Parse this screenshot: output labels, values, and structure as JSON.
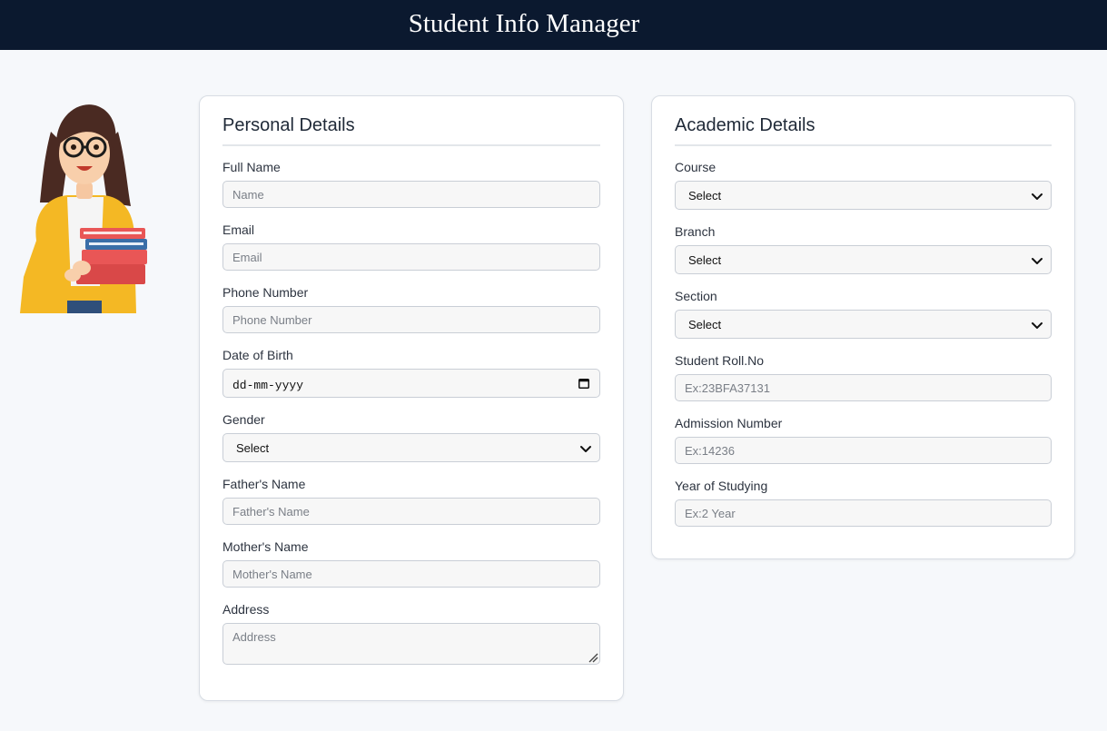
{
  "header": {
    "title": "Student Info Manager"
  },
  "personal": {
    "title": "Personal Details",
    "full_name": {
      "label": "Full Name",
      "placeholder": "Name"
    },
    "email": {
      "label": "Email",
      "placeholder": "Email"
    },
    "phone": {
      "label": "Phone Number",
      "placeholder": "Phone Number"
    },
    "dob": {
      "label": "Date of Birth",
      "value": "dd-mm-yyyy",
      "icon": "calendar-icon"
    },
    "gender": {
      "label": "Gender",
      "value": "Select",
      "icon": "chevron-down-icon"
    },
    "father": {
      "label": "Father's Name",
      "placeholder": "Father's Name"
    },
    "mother": {
      "label": "Mother's Name",
      "placeholder": "Mother's Name"
    },
    "address": {
      "label": "Address",
      "placeholder": "Address"
    }
  },
  "academic": {
    "title": "Academic Details",
    "course": {
      "label": "Course",
      "value": "Select"
    },
    "branch": {
      "label": "Branch",
      "value": "Select"
    },
    "section": {
      "label": "Section",
      "value": "Select"
    },
    "roll": {
      "label": "Student Roll.No",
      "placeholder": "Ex:23BFA37131"
    },
    "admission": {
      "label": "Admission Number",
      "placeholder": "Ex:14236"
    },
    "year": {
      "label": "Year of Studying",
      "placeholder": "Ex:2 Year"
    }
  },
  "colors": {
    "header_bg": "#0b192f",
    "page_bg": "#f6f8fb",
    "card_border": "#d8dde4",
    "field_bg": "#f7f7f7"
  }
}
